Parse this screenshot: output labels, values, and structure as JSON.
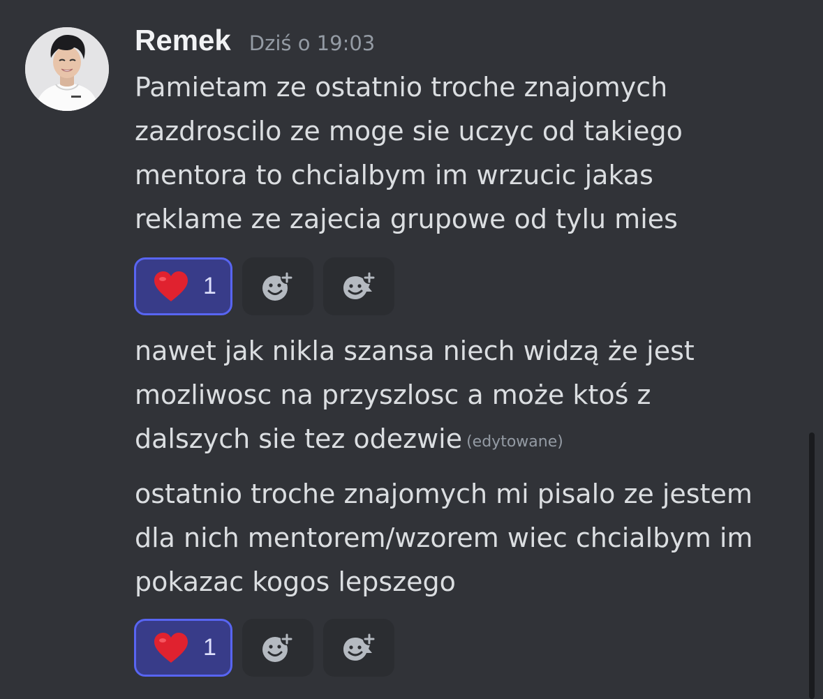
{
  "author": {
    "username": "Remek",
    "timestamp": "Dziś o 19:03"
  },
  "messages": [
    {
      "lines": [
        "Pamietam ze ostatnio troche znajomych",
        "zazdroscilo ze moge sie uczyc od takiego",
        "mentora to chcialbym im wrzucic jakas",
        "reklame ze zajecia grupowe od tylu mies"
      ],
      "reaction": {
        "emoji": "heart",
        "count": "1"
      }
    },
    {
      "lines": [
        "nawet jak nikla szansa niech widzą że jest",
        "mozliwosc na przyszlosc a może ktoś z",
        "dalszych sie tez odezwie"
      ],
      "edited_label": "(edytowane)"
    },
    {
      "lines": [
        "ostatnio troche znajomych mi pisalo ze jestem",
        "dla nich mentorem/wzorem wiec chcialbym im",
        "pokazac kogos lepszego"
      ],
      "reaction": {
        "emoji": "heart",
        "count": "1"
      }
    }
  ],
  "icons": {
    "add_reaction": "add-reaction-icon",
    "add_super_reaction": "add-super-reaction-icon",
    "reaction_emoji": "heart-icon"
  },
  "colors": {
    "background": "#313338",
    "reaction_active_bg": "#383c89",
    "reaction_active_border": "#5865f2",
    "button_bg": "#2b2d31"
  }
}
